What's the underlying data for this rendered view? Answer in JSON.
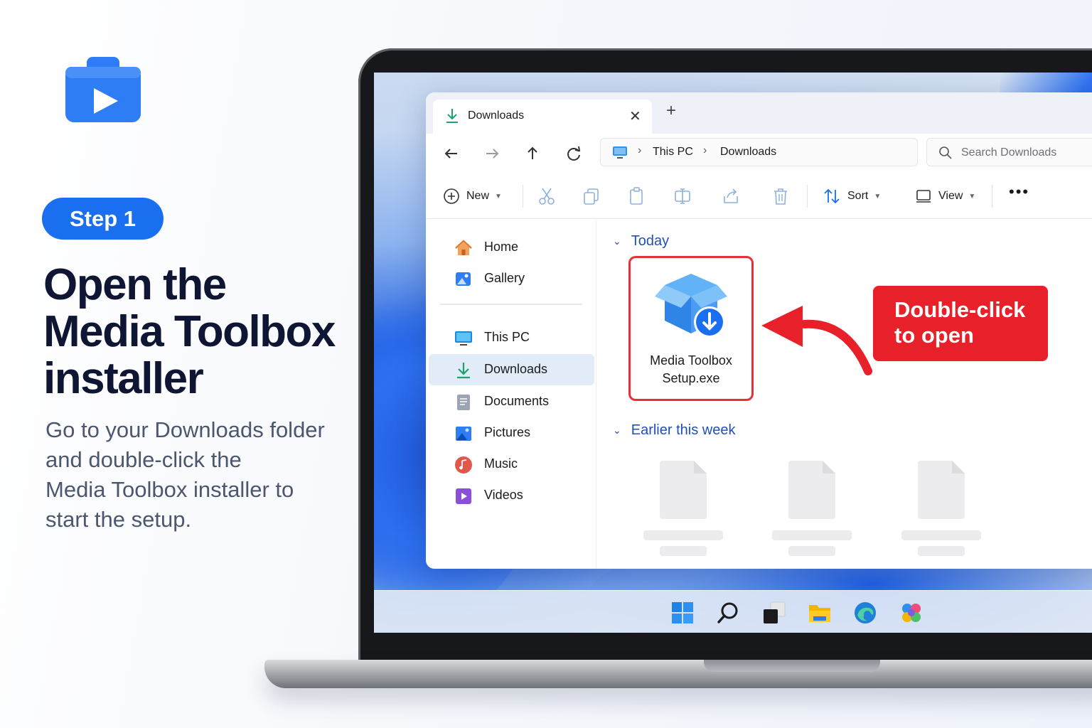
{
  "promo": {
    "step_label": "Step 1",
    "headline": [
      "Open the",
      "Media Toolbox",
      "installer"
    ],
    "description": [
      "Go to your Downloads folder",
      "and double-click the",
      "Media Toolbox installer to",
      "start the setup."
    ]
  },
  "explorer": {
    "tab_title": "Downloads",
    "address": {
      "crumbs": [
        "This PC",
        "Downloads"
      ]
    },
    "search": {
      "placeholder": "Search Downloads",
      "value": ""
    },
    "toolbar": {
      "new_label": "New",
      "sort_label": "Sort",
      "view_label": "View"
    },
    "sidebar": {
      "items": [
        {
          "label": "Home",
          "icon": "home-icon"
        },
        {
          "label": "Gallery",
          "icon": "gallery-icon"
        },
        {
          "label": "This PC",
          "icon": "computer-icon"
        },
        {
          "label": "Downloads",
          "icon": "download-icon",
          "selected": true
        },
        {
          "label": "Documents",
          "icon": "document-icon"
        },
        {
          "label": "Pictures",
          "icon": "pictures-icon"
        },
        {
          "label": "Music",
          "icon": "music-icon"
        },
        {
          "label": "Videos",
          "icon": "videos-icon"
        }
      ]
    },
    "groups": {
      "today": "Today",
      "earlier": "Earlier this week"
    },
    "file": {
      "name_line1": "Media Toolbox",
      "name_line2": "Setup.exe"
    }
  },
  "callout": {
    "line1": "Double-click",
    "line2": "to open"
  },
  "colors": {
    "accent": "#1a6ef0",
    "callout": "#e8202a",
    "link": "#1f4fb8"
  }
}
